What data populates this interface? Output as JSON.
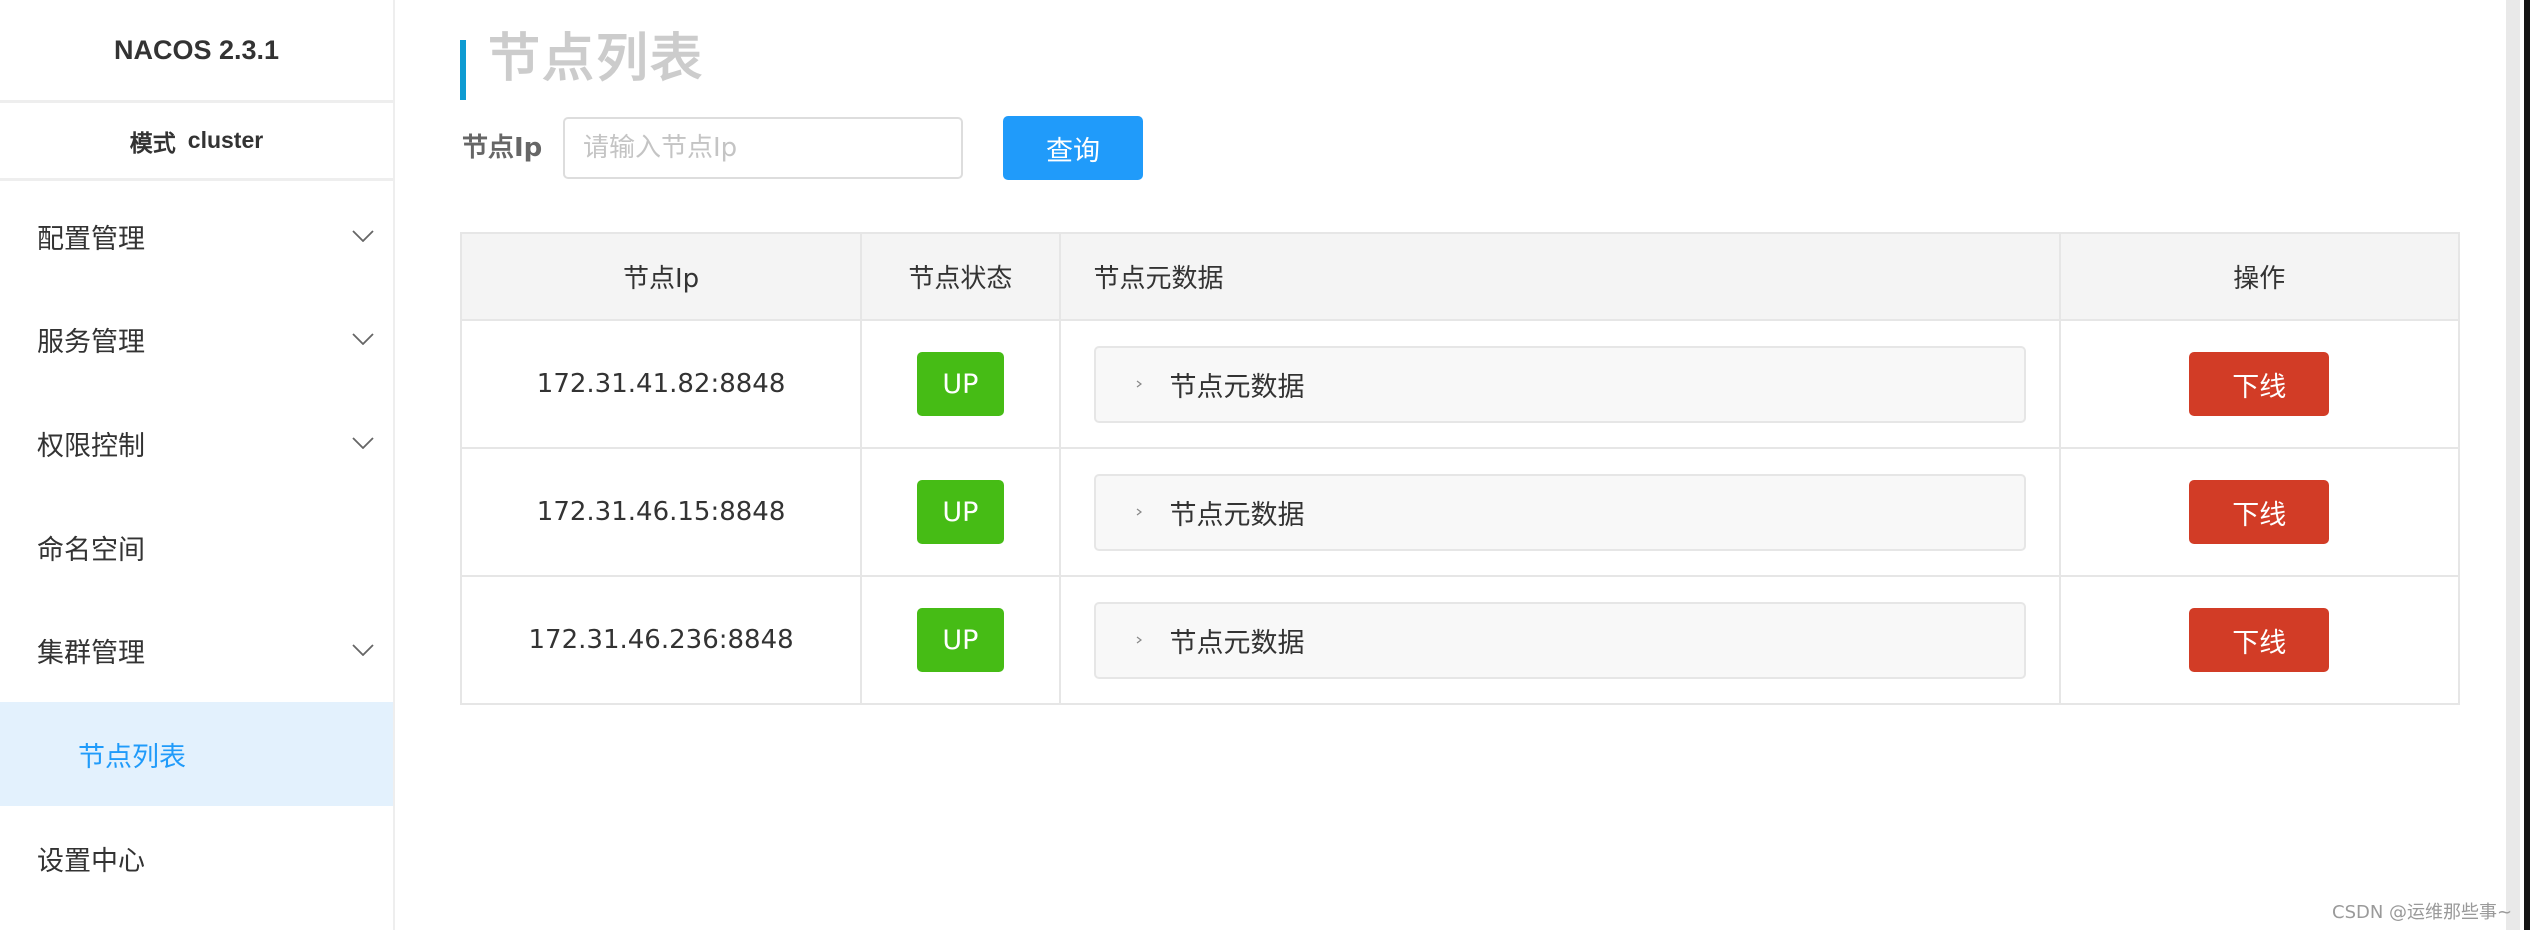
{
  "sidebar": {
    "logo": "NACOS 2.3.1",
    "mode_label": "模式",
    "mode_value": "cluster",
    "items": [
      {
        "label": "配置管理",
        "expandable": true,
        "icon": "chevron-down-icon"
      },
      {
        "label": "服务管理",
        "expandable": true,
        "icon": "chevron-down-icon"
      },
      {
        "label": "权限控制",
        "expandable": true,
        "icon": "chevron-down-icon"
      },
      {
        "label": "命名空间",
        "expandable": false
      },
      {
        "label": "集群管理",
        "expandable": true,
        "icon": "chevron-down-icon"
      },
      {
        "label": "节点列表",
        "sub": true,
        "active": true
      },
      {
        "label": "设置中心",
        "expandable": false
      }
    ]
  },
  "page": {
    "title": "节点列表"
  },
  "filter": {
    "label": "节点Ip",
    "value": "",
    "placeholder": "请输入节点Ip",
    "query_button": "查询"
  },
  "table": {
    "columns": [
      "节点Ip",
      "节点状态",
      "节点元数据",
      "操作"
    ],
    "rows": [
      {
        "ip": "172.31.41.82:8848",
        "status": "UP",
        "metadata_label": "节点元数据",
        "action": "下线"
      },
      {
        "ip": "172.31.46.15:8848",
        "status": "UP",
        "metadata_label": "节点元数据",
        "action": "下线"
      },
      {
        "ip": "172.31.46.236:8848",
        "status": "UP",
        "metadata_label": "节点元数据",
        "action": "下线"
      }
    ]
  },
  "colors": {
    "primary": "#209bfa",
    "status_up": "#46bc15",
    "danger": "#d23c26",
    "title_accent": "#0e9bd2",
    "active_menu_bg": "#e3f1fd"
  },
  "watermark": "CSDN @运维那些事~"
}
